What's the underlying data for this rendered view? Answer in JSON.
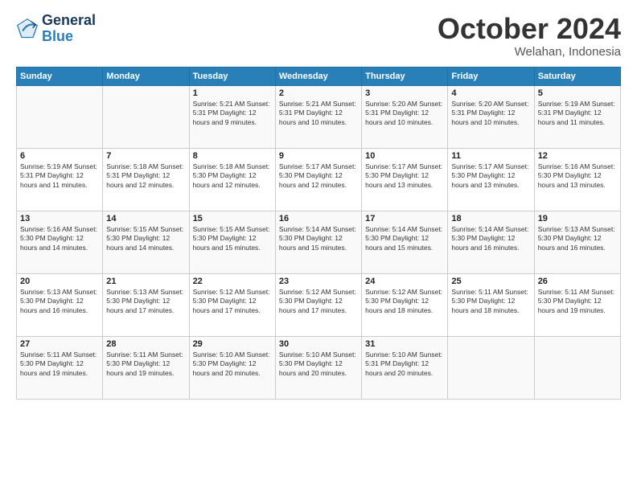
{
  "logo": {
    "line1": "General",
    "line2": "Blue"
  },
  "title": "October 2024",
  "subtitle": "Welahan, Indonesia",
  "days_of_week": [
    "Sunday",
    "Monday",
    "Tuesday",
    "Wednesday",
    "Thursday",
    "Friday",
    "Saturday"
  ],
  "weeks": [
    [
      {
        "day": "",
        "info": ""
      },
      {
        "day": "",
        "info": ""
      },
      {
        "day": "1",
        "info": "Sunrise: 5:21 AM\nSunset: 5:31 PM\nDaylight: 12 hours and 9 minutes."
      },
      {
        "day": "2",
        "info": "Sunrise: 5:21 AM\nSunset: 5:31 PM\nDaylight: 12 hours and 10 minutes."
      },
      {
        "day": "3",
        "info": "Sunrise: 5:20 AM\nSunset: 5:31 PM\nDaylight: 12 hours and 10 minutes."
      },
      {
        "day": "4",
        "info": "Sunrise: 5:20 AM\nSunset: 5:31 PM\nDaylight: 12 hours and 10 minutes."
      },
      {
        "day": "5",
        "info": "Sunrise: 5:19 AM\nSunset: 5:31 PM\nDaylight: 12 hours and 11 minutes."
      }
    ],
    [
      {
        "day": "6",
        "info": "Sunrise: 5:19 AM\nSunset: 5:31 PM\nDaylight: 12 hours and 11 minutes."
      },
      {
        "day": "7",
        "info": "Sunrise: 5:18 AM\nSunset: 5:31 PM\nDaylight: 12 hours and 12 minutes."
      },
      {
        "day": "8",
        "info": "Sunrise: 5:18 AM\nSunset: 5:30 PM\nDaylight: 12 hours and 12 minutes."
      },
      {
        "day": "9",
        "info": "Sunrise: 5:17 AM\nSunset: 5:30 PM\nDaylight: 12 hours and 12 minutes."
      },
      {
        "day": "10",
        "info": "Sunrise: 5:17 AM\nSunset: 5:30 PM\nDaylight: 12 hours and 13 minutes."
      },
      {
        "day": "11",
        "info": "Sunrise: 5:17 AM\nSunset: 5:30 PM\nDaylight: 12 hours and 13 minutes."
      },
      {
        "day": "12",
        "info": "Sunrise: 5:16 AM\nSunset: 5:30 PM\nDaylight: 12 hours and 13 minutes."
      }
    ],
    [
      {
        "day": "13",
        "info": "Sunrise: 5:16 AM\nSunset: 5:30 PM\nDaylight: 12 hours and 14 minutes."
      },
      {
        "day": "14",
        "info": "Sunrise: 5:15 AM\nSunset: 5:30 PM\nDaylight: 12 hours and 14 minutes."
      },
      {
        "day": "15",
        "info": "Sunrise: 5:15 AM\nSunset: 5:30 PM\nDaylight: 12 hours and 15 minutes."
      },
      {
        "day": "16",
        "info": "Sunrise: 5:14 AM\nSunset: 5:30 PM\nDaylight: 12 hours and 15 minutes."
      },
      {
        "day": "17",
        "info": "Sunrise: 5:14 AM\nSunset: 5:30 PM\nDaylight: 12 hours and 15 minutes."
      },
      {
        "day": "18",
        "info": "Sunrise: 5:14 AM\nSunset: 5:30 PM\nDaylight: 12 hours and 16 minutes."
      },
      {
        "day": "19",
        "info": "Sunrise: 5:13 AM\nSunset: 5:30 PM\nDaylight: 12 hours and 16 minutes."
      }
    ],
    [
      {
        "day": "20",
        "info": "Sunrise: 5:13 AM\nSunset: 5:30 PM\nDaylight: 12 hours and 16 minutes."
      },
      {
        "day": "21",
        "info": "Sunrise: 5:13 AM\nSunset: 5:30 PM\nDaylight: 12 hours and 17 minutes."
      },
      {
        "day": "22",
        "info": "Sunrise: 5:12 AM\nSunset: 5:30 PM\nDaylight: 12 hours and 17 minutes."
      },
      {
        "day": "23",
        "info": "Sunrise: 5:12 AM\nSunset: 5:30 PM\nDaylight: 12 hours and 17 minutes."
      },
      {
        "day": "24",
        "info": "Sunrise: 5:12 AM\nSunset: 5:30 PM\nDaylight: 12 hours and 18 minutes."
      },
      {
        "day": "25",
        "info": "Sunrise: 5:11 AM\nSunset: 5:30 PM\nDaylight: 12 hours and 18 minutes."
      },
      {
        "day": "26",
        "info": "Sunrise: 5:11 AM\nSunset: 5:30 PM\nDaylight: 12 hours and 19 minutes."
      }
    ],
    [
      {
        "day": "27",
        "info": "Sunrise: 5:11 AM\nSunset: 5:30 PM\nDaylight: 12 hours and 19 minutes."
      },
      {
        "day": "28",
        "info": "Sunrise: 5:11 AM\nSunset: 5:30 PM\nDaylight: 12 hours and 19 minutes."
      },
      {
        "day": "29",
        "info": "Sunrise: 5:10 AM\nSunset: 5:30 PM\nDaylight: 12 hours and 20 minutes."
      },
      {
        "day": "30",
        "info": "Sunrise: 5:10 AM\nSunset: 5:30 PM\nDaylight: 12 hours and 20 minutes."
      },
      {
        "day": "31",
        "info": "Sunrise: 5:10 AM\nSunset: 5:31 PM\nDaylight: 12 hours and 20 minutes."
      },
      {
        "day": "",
        "info": ""
      },
      {
        "day": "",
        "info": ""
      }
    ]
  ]
}
